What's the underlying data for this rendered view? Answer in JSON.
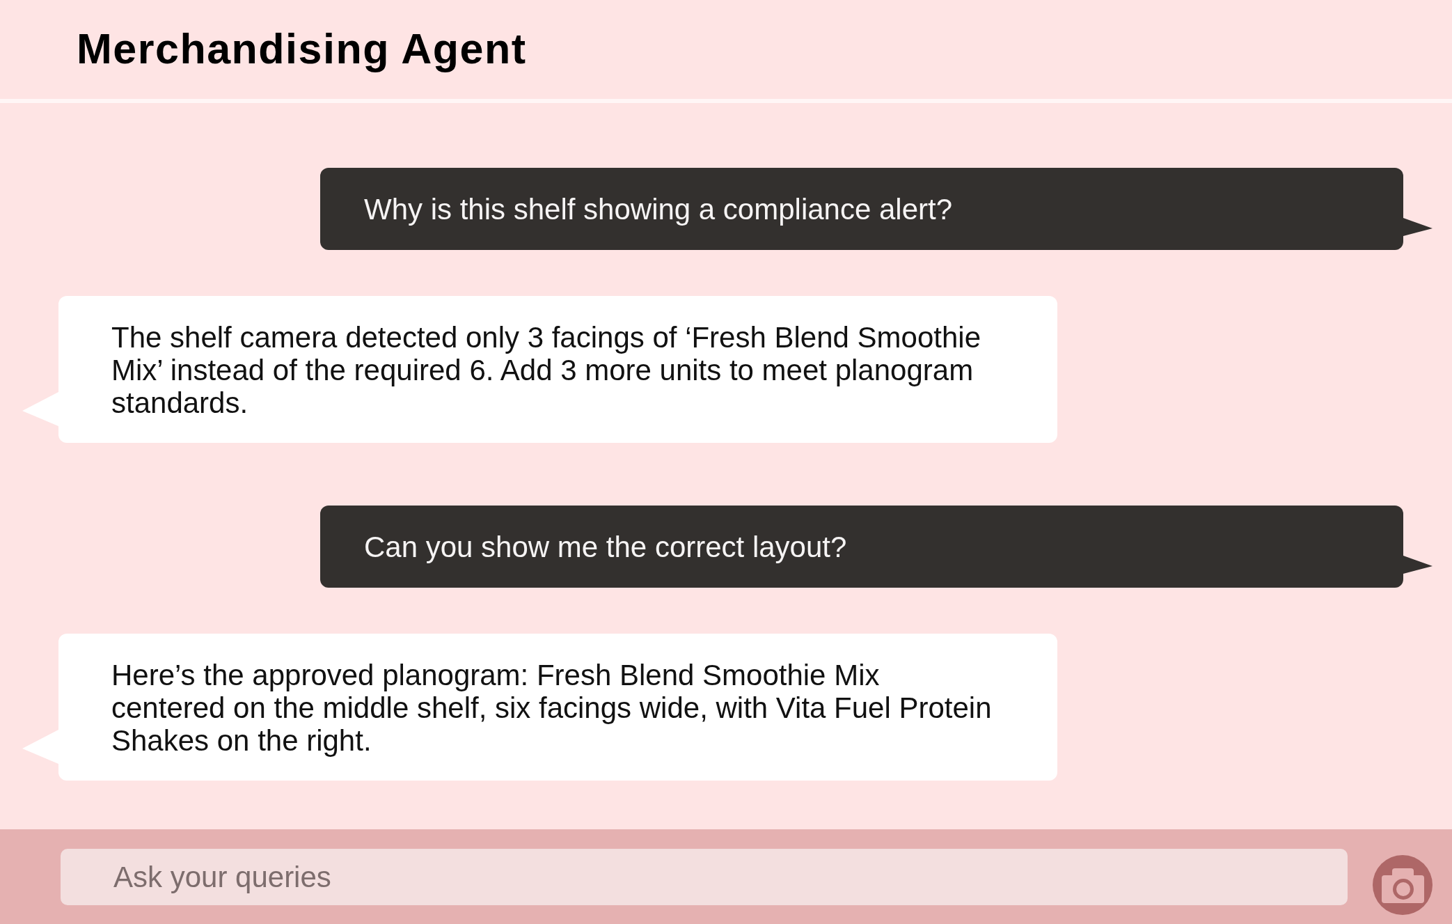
{
  "header": {
    "title": "Merchandising Agent"
  },
  "messages": [
    {
      "kind": "user",
      "text": "Why is this shelf showing a compliance alert?"
    },
    {
      "kind": "agent",
      "text": "The shelf camera detected only 3 facings of ‘Fresh Blend Smoothie Mix’ instead of the required 6. Add 3 more units to meet planogram standards."
    },
    {
      "kind": "user",
      "text": "Can you show me the correct layout?"
    },
    {
      "kind": "agent",
      "text": "Here’s the approved planogram: Fresh Blend Smoothie Mix centered on the middle shelf, six facings wide, with Vita Fuel Protein Shakes on the right."
    }
  ],
  "composer": {
    "placeholder": "Ask your queries"
  }
}
